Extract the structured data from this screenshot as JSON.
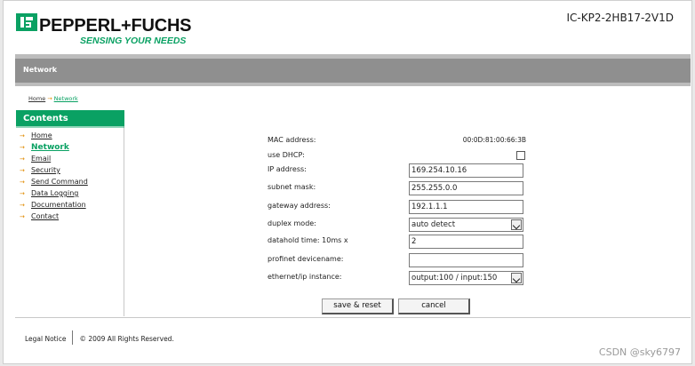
{
  "header": {
    "brand": "PEPPERL+FUCHS",
    "tagline": "SENSING YOUR NEEDS",
    "device_id": "IC-KP2-2HB17-2V1D"
  },
  "band": {
    "title": "Network"
  },
  "breadcrumb": {
    "home": "Home",
    "separator": "→",
    "current": "Network"
  },
  "sidebar": {
    "title": "Contents",
    "items": [
      {
        "label": "Home"
      },
      {
        "label": "Network",
        "active": true
      },
      {
        "label": "Email"
      },
      {
        "label": "Security"
      },
      {
        "label": "Send Command"
      },
      {
        "label": "Data Logging"
      },
      {
        "label": "Documentation"
      },
      {
        "label": "Contact"
      }
    ]
  },
  "form": {
    "mac_label": "MAC address:",
    "mac_value": "00:0D:81:00:66:3B",
    "dhcp_label": "use DHCP:",
    "dhcp_checked": false,
    "ip_label": "IP address:",
    "ip_value": "169.254.10.16",
    "subnet_label": "subnet mask:",
    "subnet_value": "255.255.0.0",
    "gateway_label": "gateway address:",
    "gateway_value": "192.1.1.1",
    "duplex_label": "duplex mode:",
    "duplex_value": "auto detect",
    "datahold_label": "datahold time: 10ms x",
    "datahold_value": "2",
    "profinet_label": "profinet devicename:",
    "profinet_value": "",
    "ethip_label": "ethernet/ip instance:",
    "ethip_value": "output:100 / input:150"
  },
  "buttons": {
    "save": "save & reset",
    "cancel": "cancel"
  },
  "footer": {
    "legal": "Legal Notice",
    "copyright": "© 2009 All Rights Reserved."
  },
  "watermark": "CSDN @sky6797",
  "colors": {
    "brand_green": "#0aa163",
    "band_grey": "#8f8f8f",
    "accent_orange": "#e08a00"
  }
}
